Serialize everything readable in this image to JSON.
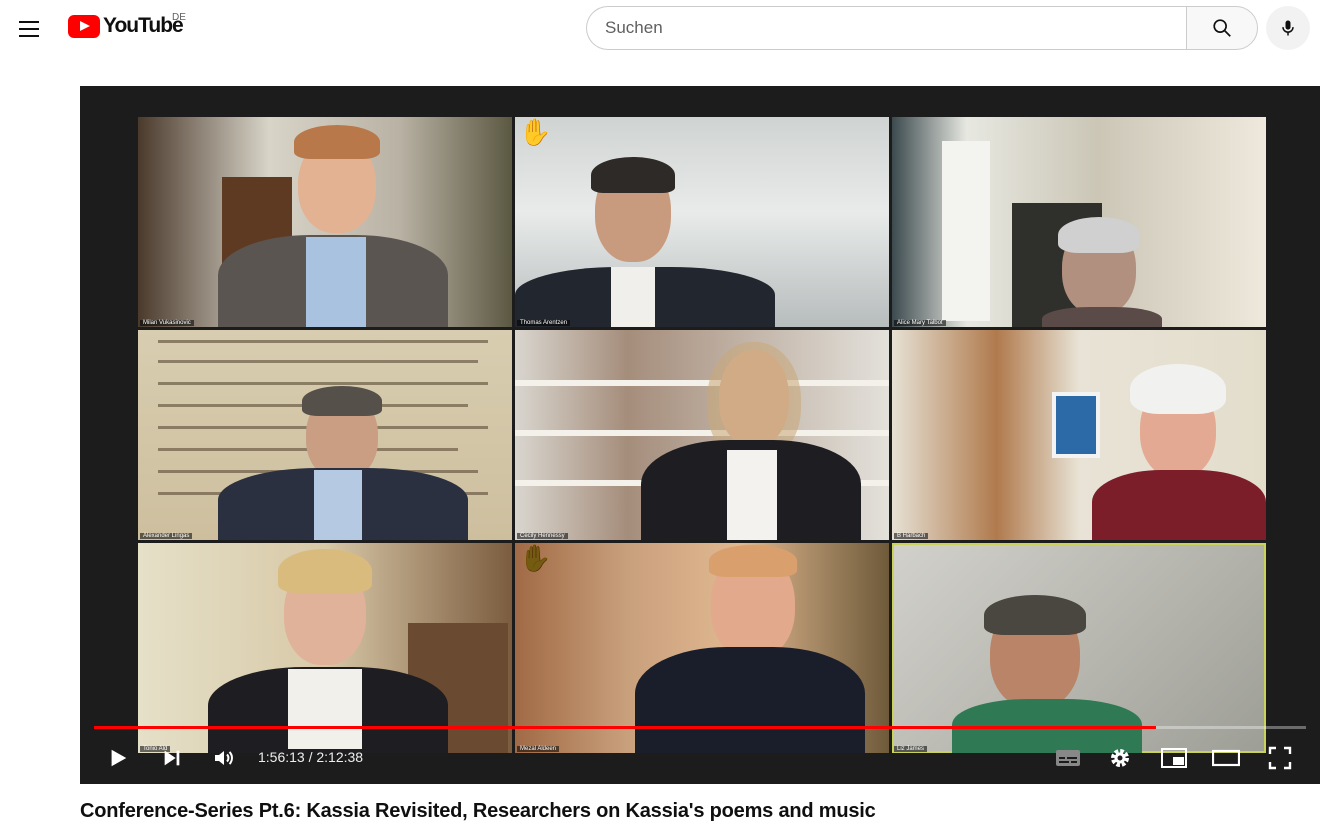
{
  "header": {
    "logo_text": "YouTube",
    "country_code": "DE",
    "search_placeholder": "Suchen"
  },
  "player": {
    "current_time": "1:56:13",
    "duration": "2:12:38",
    "time_display": "1:56:13 / 2:12:38",
    "progress_fraction": 0.876,
    "participants": [
      {
        "name": "Milan Vukasinovic",
        "hand_raised": false
      },
      {
        "name": "Thomas Arentzen",
        "hand_raised": true
      },
      {
        "name": "Alice Mary Talbot",
        "hand_raised": false
      },
      {
        "name": "Alexander Lingas",
        "hand_raised": false
      },
      {
        "name": "Cecily Hennessy",
        "hand_raised": false
      },
      {
        "name": "B Harbach",
        "hand_raised": false
      },
      {
        "name": "Tonio Ald",
        "hand_raised": false
      },
      {
        "name": "Mezal Aldeen",
        "hand_raised": true
      },
      {
        "name": "Liz James",
        "hand_raised": false
      }
    ],
    "hand_emoji": "✋"
  },
  "video": {
    "title": "Conference-Series Pt.6: Kassia Revisited, Researchers on Kassia's poems and music"
  },
  "colors": {
    "brand_red": "#ff0000",
    "player_bg": "#1c1c1c",
    "active_speaker_border": "#c9d35a"
  }
}
